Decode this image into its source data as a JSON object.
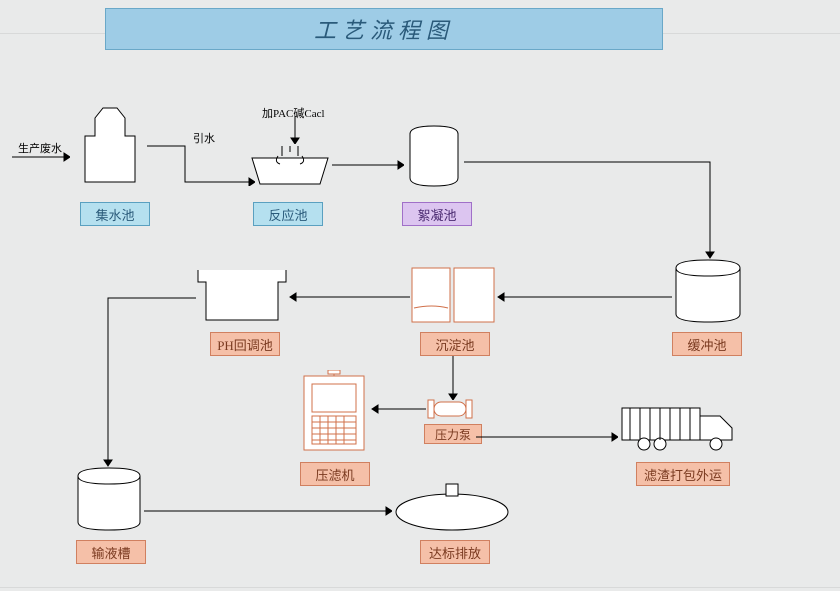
{
  "title": "工艺流程图",
  "annotations": {
    "input": "生产废水",
    "add_water": "引水",
    "add_chem": "加PAC碱Cacl"
  },
  "nodes": {
    "collect": "集水池",
    "reaction": "反应池",
    "floc": "絮凝池",
    "buffer": "缓冲池",
    "settle": "沉淀池",
    "ph": "PH回调池",
    "pump": "压力泵",
    "press": "压滤机",
    "slag_out": "滤渣打包外运",
    "sludge_tank": "输液槽",
    "discharge": "达标排放"
  }
}
